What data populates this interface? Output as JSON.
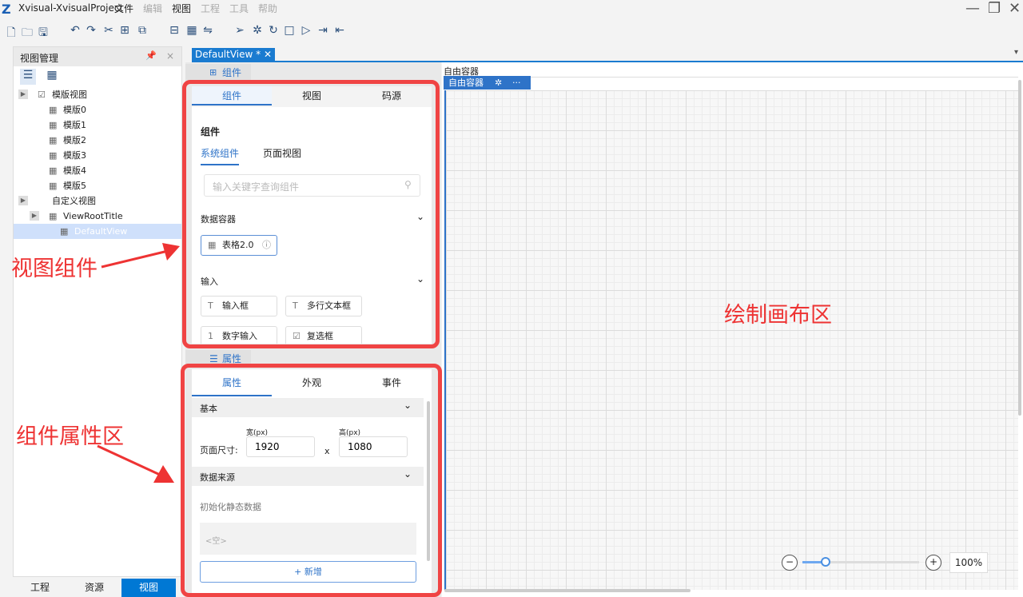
{
  "app": {
    "title": "Xvisual-XvisualProject",
    "menus": [
      {
        "label": "文件",
        "enabled": true
      },
      {
        "label": "编辑",
        "enabled": false
      },
      {
        "label": "视图",
        "enabled": true
      },
      {
        "label": "工程",
        "enabled": false
      },
      {
        "label": "工具",
        "enabled": false
      },
      {
        "label": "帮助",
        "enabled": false
      }
    ]
  },
  "left_panel": {
    "title": "视图管理",
    "tree": [
      {
        "label": "模版视图",
        "level": 0,
        "expander": true
      },
      {
        "label": "模版0",
        "level": 1
      },
      {
        "label": "模版1",
        "level": 1
      },
      {
        "label": "模版2",
        "level": 1
      },
      {
        "label": "模版3",
        "level": 1
      },
      {
        "label": "模版4",
        "level": 1
      },
      {
        "label": "模版5",
        "level": 1
      },
      {
        "label": "自定义视图",
        "level": 0,
        "expander": true
      },
      {
        "label": "ViewRootTitle",
        "level": 1,
        "expander": true
      },
      {
        "label": "DefaultView",
        "level": 2,
        "selected": true
      }
    ],
    "bottom_tabs": [
      "工程",
      "资源",
      "视图"
    ],
    "active_bottom_tab": "视图"
  },
  "document_tab": {
    "label": "DefaultView *"
  },
  "components": {
    "section_label": "组件",
    "tabs": [
      "组件",
      "视图",
      "码源"
    ],
    "heading": "组件",
    "subtabs": [
      "系统组件",
      "页面视图"
    ],
    "search_placeholder": "输入关键字查询组件",
    "groups": [
      {
        "name": "数据容器",
        "items": [
          "表格2.0"
        ]
      },
      {
        "name": "输入",
        "items": [
          "输入框",
          "多行文本框",
          "数字输入",
          "复选框"
        ]
      }
    ]
  },
  "properties": {
    "section_label": "属性",
    "tabs": [
      "属性",
      "外观",
      "事件"
    ],
    "basic_label": "基本",
    "size_label": "页面尺寸:",
    "width_label": "宽(px)",
    "height_label": "高(px)",
    "width": "1920",
    "height": "1080",
    "x": "x",
    "datasource_label": "数据来源",
    "init_label": "初始化静态数据",
    "empty": "<空>",
    "add_label": "+ 新增"
  },
  "canvas": {
    "container_label": "自由容器",
    "tag_label": "自由容器",
    "more": "···",
    "zoom": "100%",
    "zoom_fraction": 0.2
  },
  "annotations": {
    "view_components": "视图组件",
    "canvas_area": "绘制画布区",
    "props_area": "组件属性区"
  }
}
